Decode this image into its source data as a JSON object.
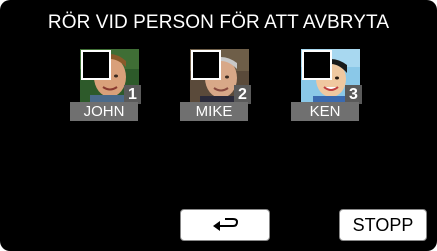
{
  "screen": {
    "title": "RÖR VID PERSON FÖR ATT AVBRYTA"
  },
  "persons": [
    {
      "number": "1",
      "name": "JOHN",
      "checked": false
    },
    {
      "number": "2",
      "name": "MIKE",
      "checked": false
    },
    {
      "number": "3",
      "name": "KEN",
      "checked": false
    }
  ],
  "controls": {
    "back_icon": "return-arrow-icon",
    "stop_label": "STOPP"
  },
  "colors": {
    "background": "#000000",
    "name_bar": "#707070",
    "button_face": "#ffffff"
  }
}
